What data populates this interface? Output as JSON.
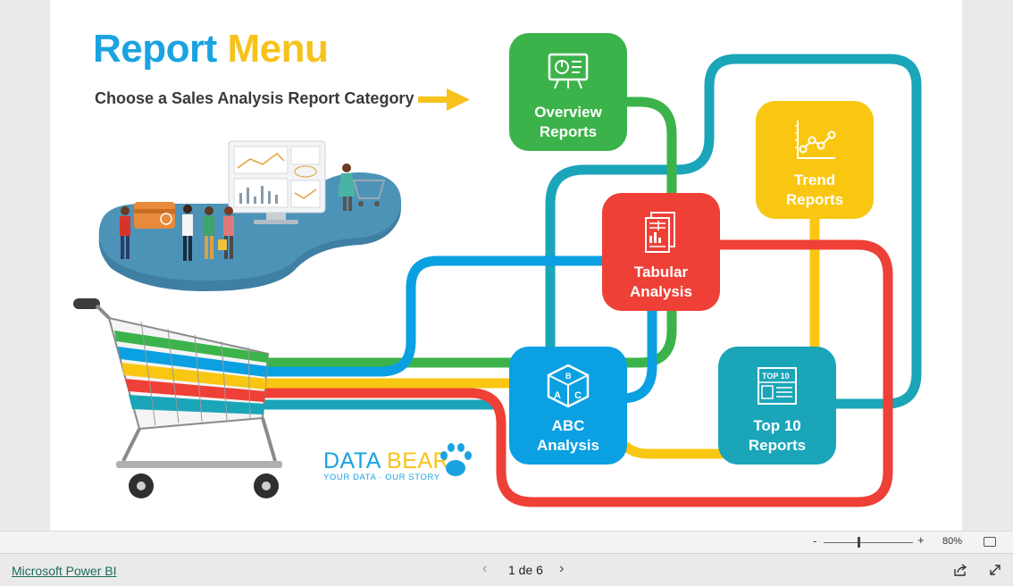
{
  "report": {
    "title_word1": "Report",
    "title_word2": "Menu",
    "subtitle": "Choose a Sales Analysis Report Category"
  },
  "tiles": {
    "overview": {
      "line1": "Overview",
      "line2": "Reports",
      "color": "#3cb34a",
      "icon": "presentation-board-icon"
    },
    "trend": {
      "line1": "Trend",
      "line2": "Reports",
      "color": "#f9c711",
      "icon": "line-chart-icon"
    },
    "tabular": {
      "line1": "Tabular",
      "line2": "Analysis",
      "color": "#ee4036",
      "icon": "report-document-icon"
    },
    "abc": {
      "line1": "ABC",
      "line2": "Analysis",
      "color": "#0aa0e2",
      "icon": "abc-cube-icon"
    },
    "top10": {
      "line1": "Top 10",
      "line2": "Reports",
      "color": "#1aa5b9",
      "icon": "top10-board-icon",
      "icon_text": "TOP 10"
    }
  },
  "brand": {
    "name_part1": "DATA ",
    "name_part2": "BEAR",
    "tagline": "YOUR DATA · OUR STORY",
    "icon": "paw-icon"
  },
  "toolbar": {
    "zoom_minus": "-",
    "zoom_plus": "+",
    "zoom_value": "80%",
    "zoom_level": 0.4
  },
  "footer": {
    "link": "Microsoft Power BI",
    "page_indicator": "1 de 6",
    "prev": "‹",
    "next": "›"
  },
  "colors": {
    "blue": "#1aa3e0",
    "yellow": "#f7c21b",
    "green": "#3cb34a",
    "red": "#ee4036",
    "teal": "#1aa5b9"
  }
}
